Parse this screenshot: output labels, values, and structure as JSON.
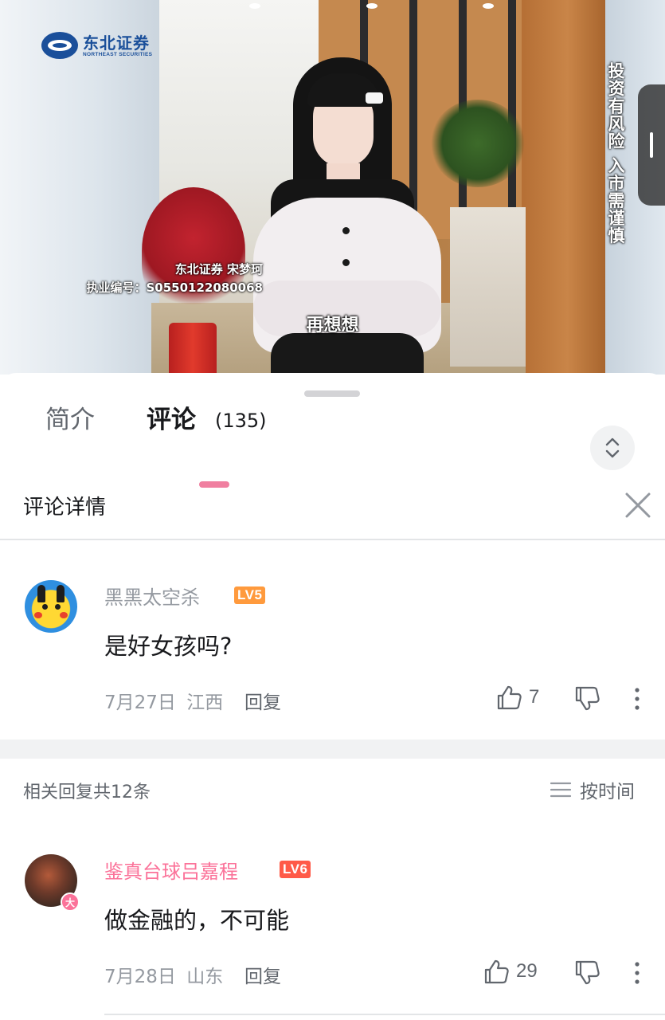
{
  "video": {
    "brand_cn": "东北证券",
    "brand_en": "NORTHEAST SECURITIES",
    "credit_line1": "东北证券 宋梦珂",
    "credit_line2": "执业编号：S0550122080068",
    "subtitle": "再想想",
    "risk_notice": "投资有风险 入市需谨慎"
  },
  "tabs": [
    {
      "label": "简介",
      "active": false
    },
    {
      "label": "评论",
      "active": true,
      "count": "(135)"
    }
  ],
  "detail": {
    "title": "评论详情"
  },
  "main_comment": {
    "username": "黑黑太空杀",
    "level": "LV5",
    "content": "是好女孩吗?",
    "date": "7月27日",
    "location": "江西",
    "reply_label": "回复",
    "likes": "7"
  },
  "replies_bar": {
    "count_text": "相关回复共12条",
    "sort_label": "按时间"
  },
  "reply_comment": {
    "username": "鉴真台球吕嘉程",
    "level": "LV6",
    "badge": "大",
    "content": "做金融的，不可能",
    "date": "7月28日",
    "location": "山东",
    "reply_label": "回复",
    "likes": "29"
  },
  "colors": {
    "accent_pink": "#fb7299",
    "lv5": "#ff9a3d",
    "lv6": "#ff5a48",
    "brand_blue": "#1a4f9a"
  }
}
